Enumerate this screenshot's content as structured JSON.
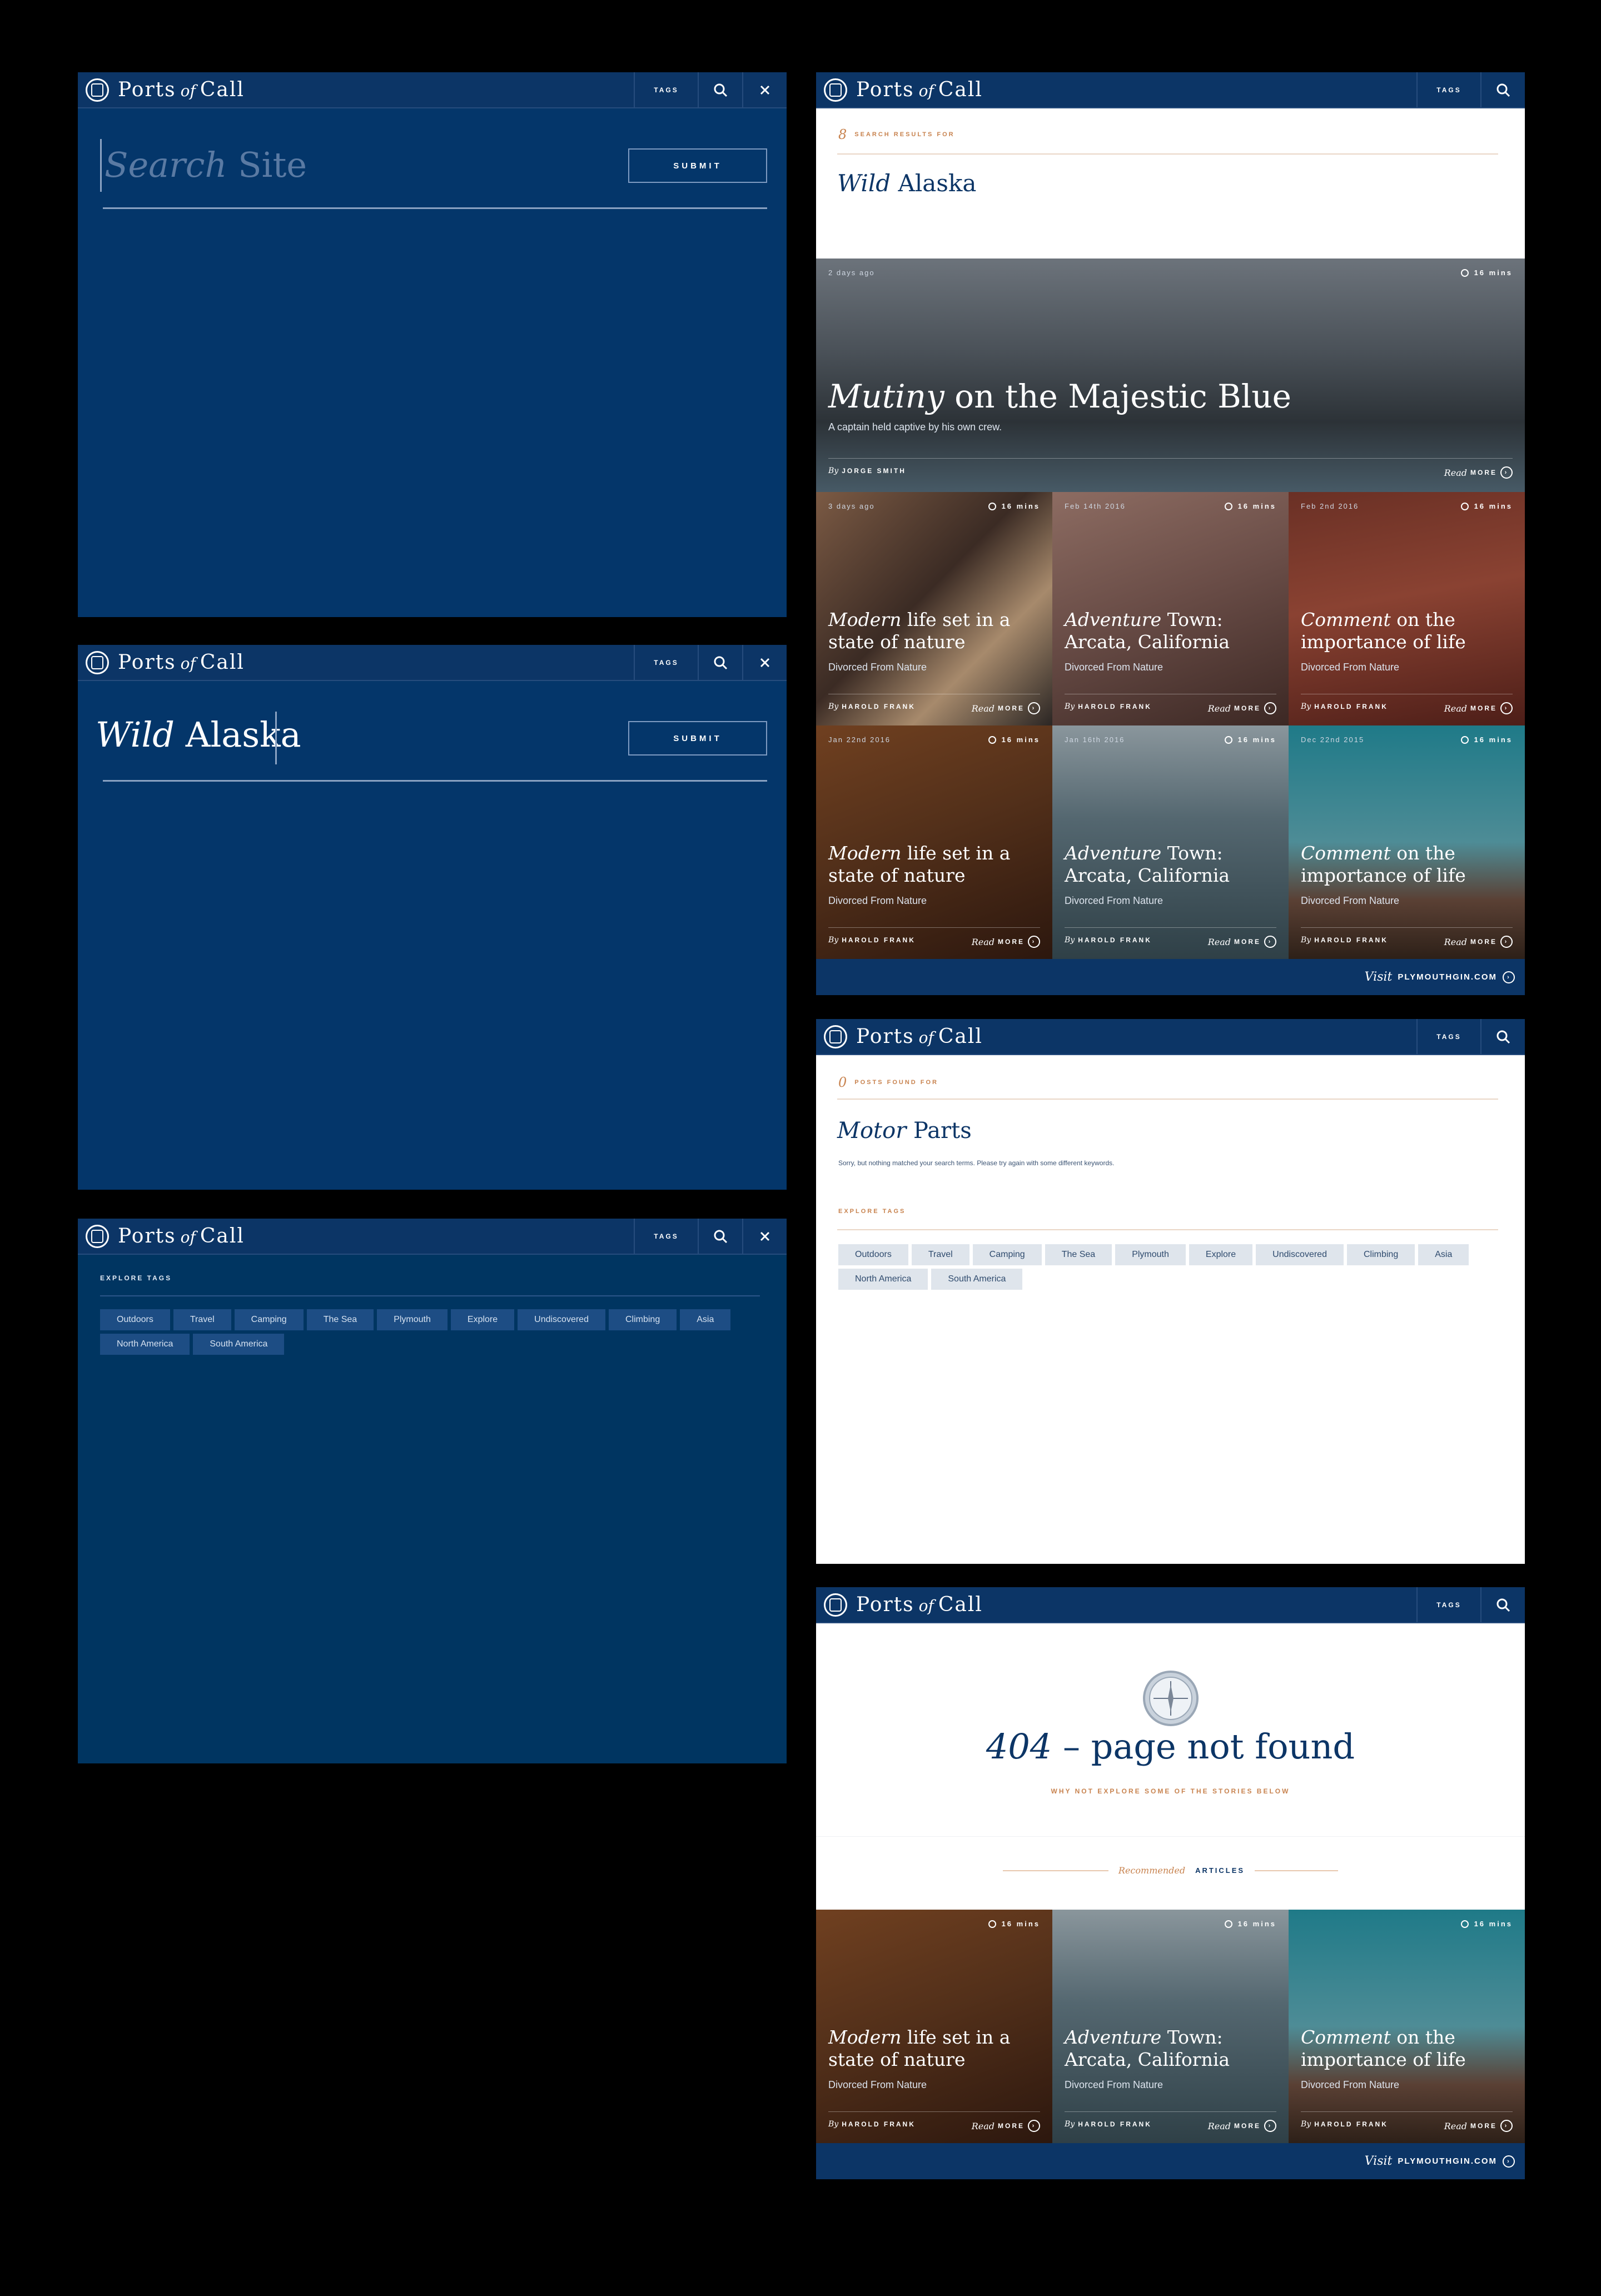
{
  "brand": {
    "ports": "Ports",
    "of": "of",
    "call": "Call"
  },
  "header": {
    "tags_label": "TAGS"
  },
  "search_overlay": {
    "placeholder_a": "Search",
    "placeholder_b": "Site",
    "submit_label": "SUBMIT"
  },
  "search_filled": {
    "query_a": "Wild",
    "query_b": "Alaska",
    "submit_label": "SUBMIT"
  },
  "tags_panel": {
    "heading": "EXPLORE TAGS"
  },
  "tags": [
    "Outdoors",
    "Travel",
    "Camping",
    "The Sea",
    "Plymouth",
    "Explore",
    "Undiscovered",
    "Climbing",
    "Asia",
    "North America",
    "South America"
  ],
  "results": {
    "count": "8",
    "count_label": "SEARCH RESULTS FOR",
    "query_a": "Wild",
    "query_b": "Alaska",
    "hero": {
      "date": "2 days ago",
      "time": "16 mins",
      "kw": "Mutiny",
      "rest": "on the Majestic Blue",
      "sub": "A captain held captive by his own crew.",
      "by": "By",
      "author": "JORGE SMITH",
      "read": "Read",
      "more": "MORE"
    },
    "cards": [
      {
        "date": "3 days ago",
        "time": "16 mins",
        "kw": "Modern",
        "rest": "life set in a state of nature",
        "sub": "Divorced From Nature",
        "by": "By",
        "author": "HAROLD FRANK",
        "read": "Read",
        "more": "MORE"
      },
      {
        "date": "Feb 14th 2016",
        "time": "16 mins",
        "kw": "Adventure",
        "rest": "Town: Arcata, California",
        "sub": "Divorced From Nature",
        "by": "By",
        "author": "HAROLD FRANK",
        "read": "Read",
        "more": "MORE"
      },
      {
        "date": "Feb 2nd 2016",
        "time": "16 mins",
        "kw": "Comment",
        "rest": "on the importance of life",
        "sub": "Divorced From Nature",
        "by": "By",
        "author": "HAROLD FRANK",
        "read": "Read",
        "more": "MORE"
      },
      {
        "date": "Jan 22nd 2016",
        "time": "16 mins",
        "kw": "Modern",
        "rest": "life set in a state of nature",
        "sub": "Divorced From Nature",
        "by": "By",
        "author": "HAROLD FRANK",
        "read": "Read",
        "more": "MORE"
      },
      {
        "date": "Jan 16th 2016",
        "time": "16 mins",
        "kw": "Adventure",
        "rest": "Town: Arcata, California",
        "sub": "Divorced From Nature",
        "by": "By",
        "author": "HAROLD FRANK",
        "read": "Read",
        "more": "MORE"
      },
      {
        "date": "Dec 22nd 2015",
        "time": "16 mins",
        "kw": "Comment",
        "rest": "on the importance of life",
        "sub": "Divorced From Nature",
        "by": "By",
        "author": "HAROLD FRANK",
        "read": "Read",
        "more": "MORE"
      }
    ]
  },
  "visit": {
    "v": "Visit",
    "site": "PLYMOUTHGIN.COM"
  },
  "noresults": {
    "count": "0",
    "count_label": "POSTS FOUND FOR",
    "query_a": "Motor",
    "query_b": "Parts",
    "message": "Sorry, but nothing matched your search terms. Please try again with some different keywords.",
    "explore": "EXPLORE TAGS"
  },
  "notfound": {
    "title_a": "404",
    "title_b": "– page not found",
    "sub": "WHY NOT EXPLORE SOME OF THE STORIES BELOW",
    "rec_a": "Recommended",
    "rec_b": "ARTICLES",
    "cards": [
      {
        "time": "16 mins",
        "kw": "Modern",
        "rest": "life set in a state of nature",
        "sub": "Divorced From Nature",
        "by": "By",
        "author": "HAROLD FRANK",
        "read": "Read",
        "more": "MORE"
      },
      {
        "time": "16 mins",
        "kw": "Adventure",
        "rest": "Town: Arcata, California",
        "sub": "Divorced From Nature",
        "by": "By",
        "author": "HAROLD FRANK",
        "read": "Read",
        "more": "MORE"
      },
      {
        "time": "16 mins",
        "kw": "Comment",
        "rest": "on the importance of life",
        "sub": "Divorced From Nature",
        "by": "By",
        "author": "HAROLD FRANK",
        "read": "Read",
        "more": "MORE"
      }
    ]
  }
}
